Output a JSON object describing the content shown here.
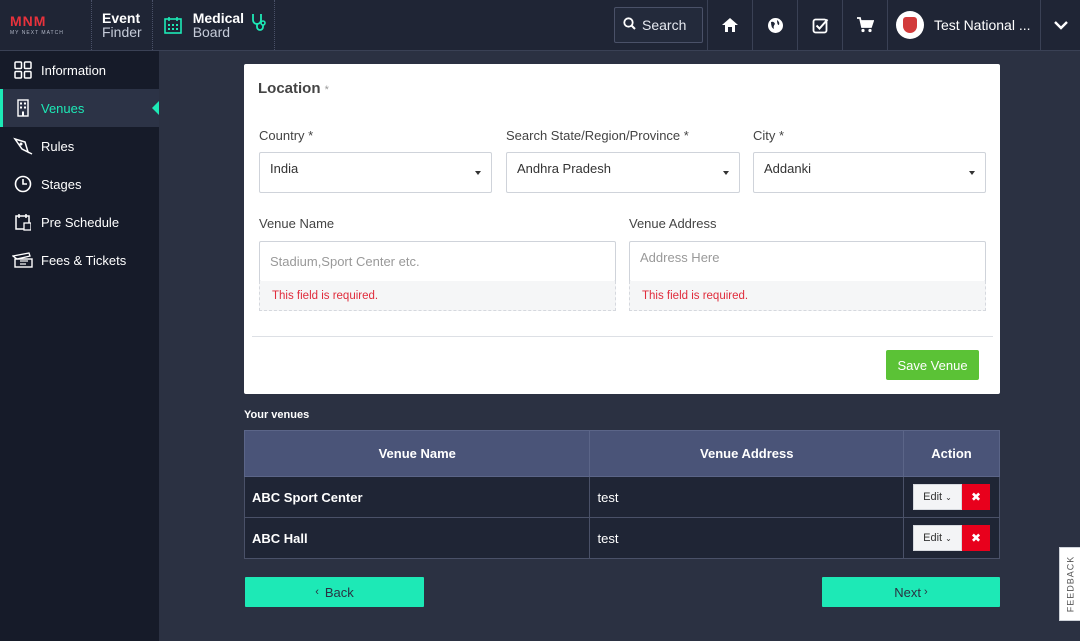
{
  "header": {
    "logo": "MNM",
    "logo_tagline": "MY NEXT MATCH",
    "event_finder": {
      "line1": "Event",
      "line2": "Finder"
    },
    "medical_board": {
      "line1": "Medical",
      "line2": "Board"
    },
    "search_label": "Search",
    "user_name": "Test National ...",
    "icons": [
      "home-icon",
      "globe-icon",
      "checklist-icon",
      "cart-icon",
      "chevron-down-icon"
    ]
  },
  "sidebar": {
    "items": [
      {
        "label": "Information",
        "icon": "grid-icon",
        "active": false
      },
      {
        "label": "Venues",
        "icon": "building-icon",
        "active": true
      },
      {
        "label": "Rules",
        "icon": "pen-icon",
        "active": false
      },
      {
        "label": "Stages",
        "icon": "clock-icon",
        "active": false
      },
      {
        "label": "Pre Schedule",
        "icon": "calendar-icon",
        "active": false
      },
      {
        "label": "Fees & Tickets",
        "icon": "ticket-icon",
        "active": false
      }
    ]
  },
  "form": {
    "title": "Location",
    "title_req": "*",
    "country": {
      "label": "Country *",
      "value": "India"
    },
    "state": {
      "label": "Search State/Region/Province *",
      "value": "Andhra Pradesh"
    },
    "city": {
      "label": "City *",
      "value": "Addanki"
    },
    "venue_name": {
      "label": "Venue Name",
      "placeholder": "Stadium,Sport Center etc.",
      "error": "This field is required."
    },
    "venue_address": {
      "label": "Venue Address",
      "placeholder": "Address Here",
      "error": "This field is required."
    },
    "save_label": "Save Venue"
  },
  "venues": {
    "heading": "Your venues",
    "columns": [
      "Venue Name",
      "Venue Address",
      "Action"
    ],
    "rows": [
      {
        "name": "ABC Sport Center",
        "address": "test",
        "edit": "Edit",
        "delete": "✖"
      },
      {
        "name": "ABC Hall",
        "address": "test",
        "edit": "Edit",
        "delete": "✖"
      }
    ]
  },
  "nav": {
    "back_label": "Back",
    "next_label": "Next"
  },
  "feedback_label": "FEEDBACK",
  "colors": {
    "accent": "#1de9b6",
    "save": "#5bc236",
    "danger": "#e8001c",
    "error_text": "#e02c3c",
    "bg": "#2b3142",
    "sidebar": "#161b29",
    "table_header": "#4a5478"
  }
}
